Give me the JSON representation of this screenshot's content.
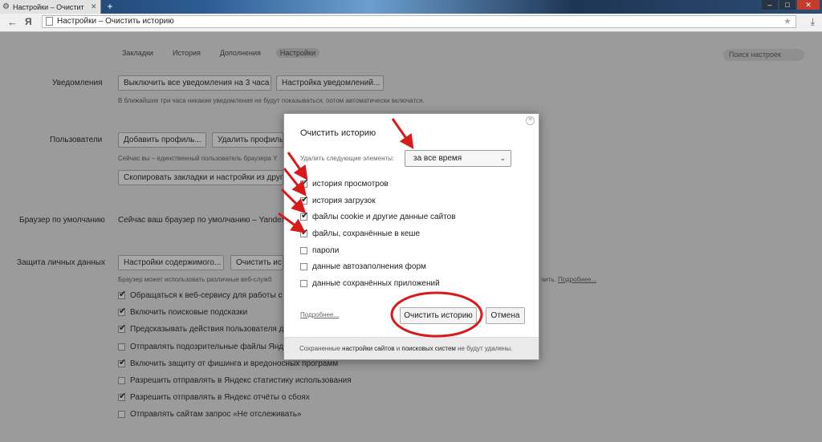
{
  "browser": {
    "tab_title": "Настройки – Очистит",
    "url": "Настройки – Очистить историю",
    "brand_letter": "Я"
  },
  "nav_tabs": [
    "Закладки",
    "История",
    "Дополнения",
    "Настройки"
  ],
  "search_placeholder": "Поиск настроек",
  "sections": {
    "notifications": {
      "label": "Уведомления",
      "btn_disable": "Выключить все уведомления на 3 часа",
      "btn_settings": "Настройка уведомлений...",
      "note": "В ближайшие три часа никакие уведомления не будут показываться, потом автоматически включатся."
    },
    "users": {
      "label": "Пользователи",
      "btn_add": "Добавить профиль...",
      "btn_remove": "Удалить профиль",
      "note": "Сейчас вы – единственный пользователь браузера Y",
      "btn_copy": "Скопировать закладки и настройки из друго"
    },
    "default_browser": {
      "label": "Браузер по умолчанию",
      "text": "Сейчас ваш браузер по умолчанию – Yandex."
    },
    "privacy": {
      "label": "Защита личных данных",
      "btn_content": "Настройки содержимого...",
      "btn_clear": "Очистить ис",
      "note": "Браузер может использовать различные веб-служб",
      "note_right": "чить.",
      "note_link": "Подробнее...",
      "checkboxes": [
        {
          "label": "Обращаться к веб-сервису для работы с о",
          "checked": true
        },
        {
          "label": "Включить поисковые подсказки",
          "checked": true
        },
        {
          "label": "Предсказывать действия пользователя дл",
          "checked": true
        },
        {
          "label": "Отправлять подозрительные файлы Яндек",
          "checked": false
        },
        {
          "label": "Включить защиту от фишинга и вредоносных программ",
          "checked": true
        },
        {
          "label": "Разрешить отправлять в Яндекс статистику использования",
          "checked": false
        },
        {
          "label": "Разрешить отправлять в Яндекс отчёты о сбоях",
          "checked": true
        },
        {
          "label": "Отправлять сайтам запрос «Не отслеживать»",
          "checked": false
        }
      ]
    }
  },
  "dialog": {
    "title": "Очистить историю",
    "delete_label": "Удалить следующие элементы:",
    "period": "за все время",
    "items": [
      {
        "label": "история просмотров",
        "checked": true
      },
      {
        "label": "история загрузок",
        "checked": true
      },
      {
        "label": "файлы cookie и другие данные сайтов",
        "checked": true
      },
      {
        "label": "файлы, сохранённые в кеше",
        "checked": true
      },
      {
        "label": "пароли",
        "checked": false
      },
      {
        "label": "данные автозаполнения форм",
        "checked": false
      },
      {
        "label": "данные сохранённых приложений",
        "checked": false
      }
    ],
    "more_link": "Подробнее...",
    "clear_button": "Очистить историю",
    "cancel_button": "Отмена",
    "footer_pre": "Сохраненные",
    "footer_b1": "настройки сайтов",
    "footer_mid": "и",
    "footer_b2": "поисковых систем",
    "footer_post": "не будут удалены."
  },
  "colors": {
    "annotation_red": "#d81a1a",
    "overlay_gray": "#9b9b9b"
  }
}
